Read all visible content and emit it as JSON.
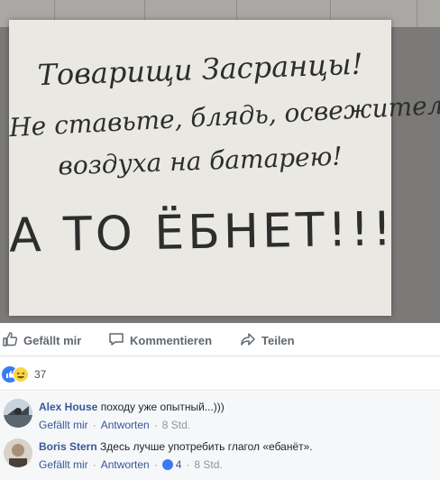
{
  "post": {
    "sign_lines": [
      "Товарищи Засранцы!",
      "Не ставьте, блядь, освежитель",
      "воздуха на батарею!",
      "А ТО ЁБНЕТ!!!"
    ]
  },
  "actions": {
    "like_label": "Gefällt mir",
    "comment_label": "Kommentieren",
    "share_label": "Teilen"
  },
  "reactions": {
    "count": "37",
    "types": [
      "like-icon",
      "haha-icon"
    ]
  },
  "comments": [
    {
      "author": "Alex House",
      "text": "походу уже опытный...)))",
      "like_label": "Gefällt mir",
      "reply_label": "Antworten",
      "time": "8 Std.",
      "likes": ""
    },
    {
      "author": "Boris Stern",
      "text": "Здесь лучше употребить глагол «ебанёт».",
      "like_label": "Gefällt mir",
      "reply_label": "Antworten",
      "time": "8 Std.",
      "likes": "4"
    }
  ],
  "colors": {
    "link": "#385898",
    "meta": "#606770",
    "like_blue": "#3b7bf3"
  }
}
